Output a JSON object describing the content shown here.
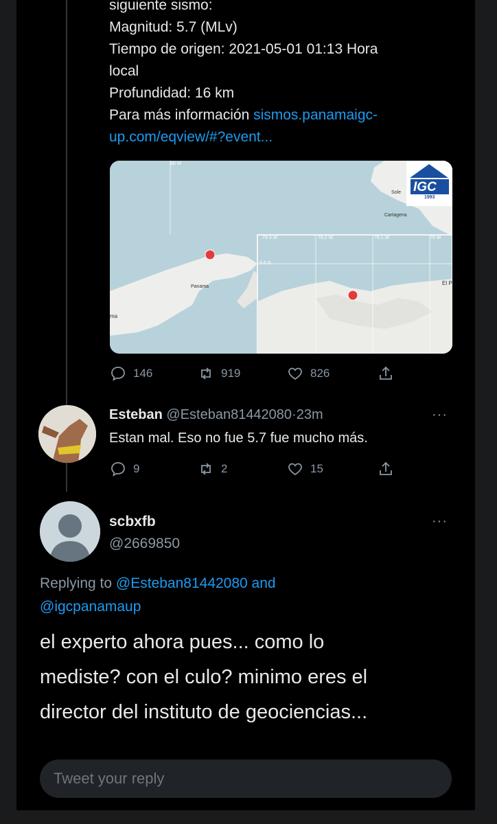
{
  "original_tweet": {
    "lines": [
      "siguiente sismo:",
      "Magnitud: 5.7 (MLv)",
      "Tiempo de origen: 2021-05-01 01:13 Hora",
      "local",
      "Profundidad: 16 km"
    ],
    "more_info_prefix": "Para más información ",
    "link_part1": "sismos.panamaigc-",
    "link_part2": "up.com/eqview/#?event...",
    "map": {
      "logo_text": "IGC",
      "logo_year": "1993",
      "labels": {
        "lon_80": "80 W",
        "sole": "Sole",
        "cartagena": "Cartagena",
        "panama": "Panama",
        "ma": "ma",
        "lon_79_3": "79.3 W",
        "lon_79_2": "79.2 W",
        "lon_79_1": "79.1 W",
        "lon_79": "79 W",
        "lat_9_6": "9.6 N",
        "el_p": "El P"
      }
    },
    "stats": {
      "replies": "146",
      "retweets": "919",
      "likes": "826"
    }
  },
  "reply1": {
    "name": "Esteban",
    "handle": "@Esteban81442080",
    "separator": "·",
    "time": "23m",
    "text": "Estan mal. Eso no fue 5.7 fue mucho más.",
    "stats": {
      "replies": "9",
      "retweets": "2",
      "likes": "15"
    },
    "more": "···"
  },
  "reply2": {
    "name": "scbxfb",
    "handle": "@2669850",
    "more": "···",
    "replying_prefix": "Replying to ",
    "replying_user1": "@Esteban81442080",
    "replying_and": " and",
    "replying_user2": "@igcpanamaup",
    "text_lines": [
      "el experto ahora pues... como lo",
      "mediste? con el culo? minimo eres el",
      "director del instituto de geociencias..."
    ]
  },
  "compose": {
    "placeholder": "Tweet your reply"
  },
  "colors": {
    "background": "#000000",
    "link": "#1d9bf0",
    "muted": "#8b98a5",
    "outer": "#1a1b1d"
  }
}
